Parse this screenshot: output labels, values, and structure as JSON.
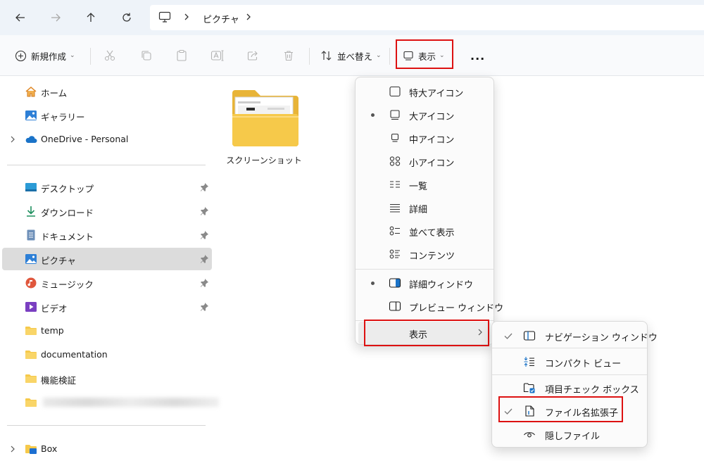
{
  "address": {
    "crumb": "ピクチャ"
  },
  "toolbar": {
    "new_label": "新規作成",
    "sort_label": "並べ替え",
    "view_label": "表示",
    "more_label": "..."
  },
  "sidebar": {
    "top_items": [
      {
        "label": "ホーム"
      },
      {
        "label": "ギャラリー"
      },
      {
        "label": "OneDrive - Personal"
      }
    ],
    "quick_access": [
      {
        "label": "デスクトップ"
      },
      {
        "label": "ダウンロード"
      },
      {
        "label": "ドキュメント"
      },
      {
        "label": "ピクチャ"
      },
      {
        "label": "ミュージック"
      },
      {
        "label": "ビデオ"
      },
      {
        "label": "temp"
      },
      {
        "label": "documentation"
      },
      {
        "label": "機能検証"
      }
    ],
    "bottom_items": [
      {
        "label": "Box"
      }
    ]
  },
  "content": {
    "folders": [
      {
        "label": "スクリーンショット"
      }
    ]
  },
  "view_menu": {
    "items": [
      {
        "label": "特大アイコン",
        "checked": false
      },
      {
        "label": "大アイコン",
        "checked": true
      },
      {
        "label": "中アイコン",
        "checked": false
      },
      {
        "label": "小アイコン",
        "checked": false
      },
      {
        "label": "一覧",
        "checked": false
      },
      {
        "label": "詳細",
        "checked": false
      },
      {
        "label": "並べて表示",
        "checked": false
      },
      {
        "label": "コンテンツ",
        "checked": false
      }
    ],
    "pane_items": [
      {
        "label": "詳細ウィンドウ",
        "checked": true
      },
      {
        "label": "プレビュー ウィンドウ",
        "checked": false
      }
    ],
    "show_label": "表示"
  },
  "show_submenu": {
    "items": [
      {
        "label": "ナビゲーション ウィンドウ",
        "checked": true
      },
      {
        "label": "コンパクト ビュー",
        "checked": false
      },
      {
        "label": "項目チェック ボックス",
        "checked": false
      },
      {
        "label": "ファイル名拡張子",
        "checked": true
      },
      {
        "label": "隠しファイル",
        "checked": false
      }
    ]
  },
  "colors": {
    "highlight_box": "#dd1111",
    "folder": "#f6c94a",
    "accent_blue": "#1a73c8"
  }
}
